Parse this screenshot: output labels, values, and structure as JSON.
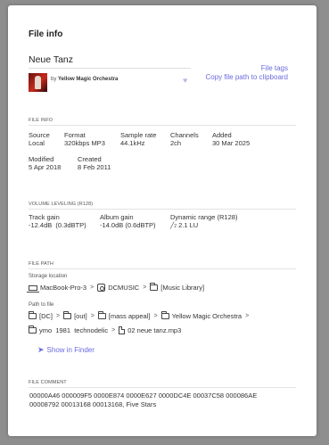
{
  "dialog": {
    "title": "File info"
  },
  "track": {
    "title": "Neue Tanz",
    "by_prefix": "by",
    "artist": "Yellow Magic Orchestra",
    "heart_icon": "heart-icon"
  },
  "links": {
    "file_tags": "File tags",
    "copy_path": "Copy file path to clipboard"
  },
  "file_info": {
    "heading": "FILE INFO",
    "source_label": "Source",
    "source_value": "Local",
    "format_label": "Format",
    "format_value": "320kbps MP3",
    "samplerate_label": "Sample rate",
    "samplerate_value": "44.1kHz",
    "channels_label": "Channels",
    "channels_value": "2ch",
    "added_label": "Added",
    "added_value": "30 Mar 2025",
    "modified_label": "Modified",
    "modified_value": "5 Apr 2018",
    "created_label": "Created",
    "created_value": "8 Feb 2011"
  },
  "volume": {
    "heading": "VOLUME LEVELING (R128)",
    "track_gain_label": "Track gain",
    "track_gain_value": "-12.4dB  (0.3dBTP)",
    "album_gain_label": "Album gain",
    "album_gain_value": "-14.0dB (0.6dBTP)",
    "dr_label": "Dynamic range (R128)",
    "dr_icon_text": "2",
    "dr_value": "2.1 LU"
  },
  "file_path": {
    "heading": "FILE PATH",
    "storage_label": "Storage location",
    "storage": [
      "MacBook-Pro-3",
      "DCMUSIC",
      "[Music Library]"
    ],
    "path_label": "Path to file",
    "path_row1": [
      "[DC]",
      "[out]",
      "[mass appeal]",
      "Yellow Magic Orchestra"
    ],
    "path_row2": [
      "ymo  1981  technodelic",
      "02 neue tanz.mp3"
    ],
    "show_in_finder": "Show in Finder"
  },
  "comment": {
    "heading": "FILE COMMENT",
    "text": "00000A46 000009F5 0000E874 0000E627 0000DC4E 00037C58 000086AE 00008792 00013168 00013168, Five Stars"
  }
}
